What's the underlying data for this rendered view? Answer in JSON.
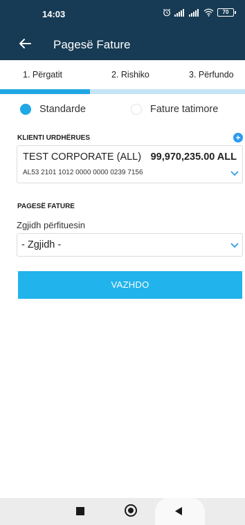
{
  "status_bar": {
    "time": "14:03",
    "battery": "70"
  },
  "header": {
    "title": "Pagesë Fature"
  },
  "steps": [
    {
      "label": "1. Përgatit"
    },
    {
      "label": "2. Rishiko"
    },
    {
      "label": "3. Përfundo"
    }
  ],
  "progress": {
    "current_step": 1,
    "total_steps": 3
  },
  "invoice_type": {
    "options": [
      {
        "label": "Standarde",
        "selected": true
      },
      {
        "label": "Fature tatimore",
        "selected": false
      }
    ]
  },
  "ordering_client": {
    "section_label": "KLIENTI URDHËRUES",
    "account_name": "TEST CORPORATE (ALL)",
    "balance": "99,970,235.00 ALL",
    "iban": "AL53 2101 1012 0000 0000 0239 7156"
  },
  "invoice_payment": {
    "section_label": "PAGESË FATURE",
    "beneficiary_label": "Zgjidh përfituesin",
    "beneficiary_value": "- Zgjidh -"
  },
  "continue_button": {
    "label": "VAZHDO"
  },
  "colors": {
    "header_bg": "#173b54",
    "accent": "#21b3eb",
    "progress_track": "#c5e4f6",
    "progress_fill": "#1fa7e4",
    "plus_icon": "#2c9af0"
  },
  "icons": [
    "back-arrow-icon",
    "alarm-icon",
    "signal-icon",
    "wifi-icon",
    "battery-icon",
    "plus-circle-icon",
    "chevron-down-icon",
    "recents-icon",
    "home-icon",
    "back-triangle-icon"
  ]
}
